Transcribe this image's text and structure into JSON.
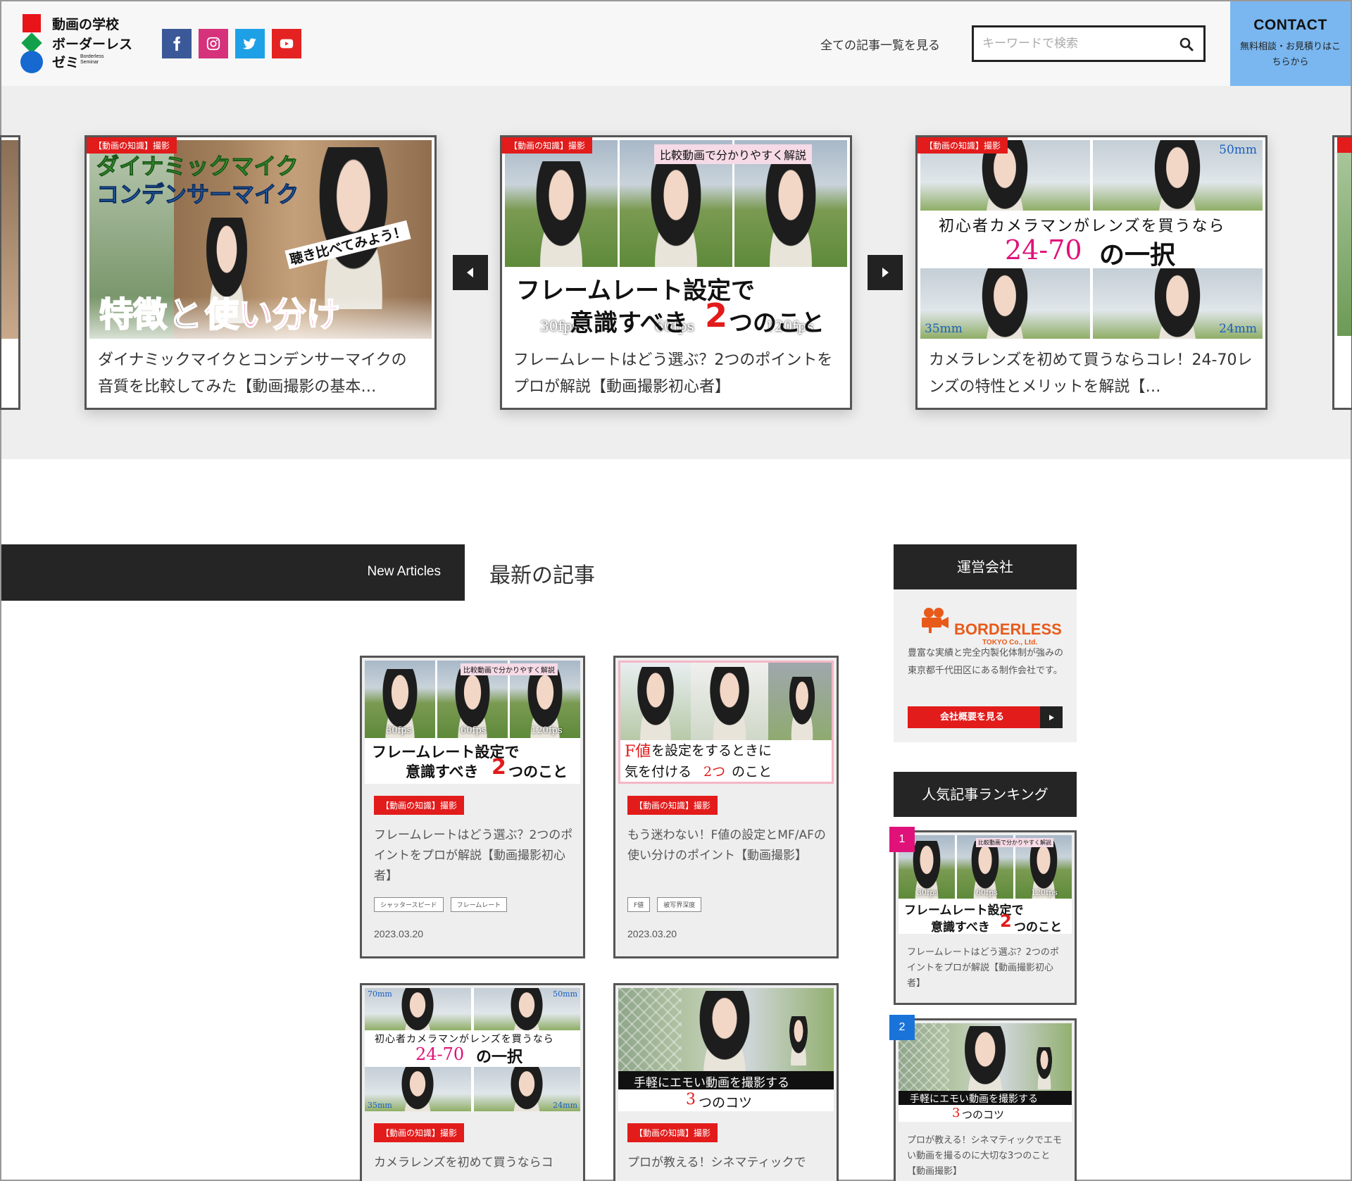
{
  "header": {
    "logo": {
      "line1": "動画の学校",
      "line2": "ボーダーレス",
      "line3": "ゼミ",
      "sub": "Borderless Seminar"
    },
    "social": [
      "facebook-icon",
      "instagram-icon",
      "twitter-icon",
      "youtube-icon"
    ],
    "all_articles_link": "全ての記事一覧を見る",
    "search": {
      "placeholder": "キーワードで検索"
    },
    "contact": {
      "title": "CONTACT",
      "subtitle": "無料相談・お見積りはこちらから"
    }
  },
  "slider": {
    "slides": [
      {
        "category": "【動画の知識】撮影",
        "title": "ダイナミックマイクとコンデンサーマイクの音質を比較してみた【動画撮影の基本…",
        "thumb_text": {
          "l1": "ダイナミックマイク",
          "l2": "コンデンサーマイク",
          "l3": "聴き比べてみよう！",
          "l4a": "特徴",
          "l4b": "と",
          "l4c": "使い分け"
        }
      },
      {
        "category": "【動画の知識】撮影",
        "title": "フレームレートはどう選ぶ？2つのポイントをプロが解説【動画撮影初心者】",
        "thumb_text": {
          "badge": "比較動画で分かりやすく解説",
          "f1": "30fps",
          "f2": "60fps",
          "f3": "120fps",
          "l1": "フレームレート設定で",
          "l2a": "意識すべき",
          "l2b": "2",
          "l2c": "つのこと"
        }
      },
      {
        "category": "【動画の知識】撮影",
        "title": "カメラレンズを初めて買うならコレ！24-70レンズの特性とメリットを解説【…",
        "thumb_text": {
          "mm1": "50mm",
          "l1": "初心者カメラマンがレンズを買うなら",
          "l2a": "24-70",
          "l2b": "の一択",
          "mm2": "35mm",
          "mm3": "24mm"
        }
      }
    ]
  },
  "new_articles": {
    "label_en": "New Articles",
    "label_jp": "最新の記事",
    "cards": [
      {
        "category": "【動画の知識】撮影",
        "title": "フレームレートはどう選ぶ？2つのポイントをプロが解説【動画撮影初心者】",
        "tags": [
          "シャッタースピード",
          "フレームレート"
        ],
        "date": "2023.03.20",
        "thumb_text": {
          "badge": "比較動画で分かりやすく解説",
          "f1": "30fps",
          "f2": "60fps",
          "f3": "120fps",
          "l1": "フレームレート設定で",
          "l2a": "意識すべき",
          "l2b": "2",
          "l2c": "つのこと"
        }
      },
      {
        "category": "【動画の知識】撮影",
        "title": "もう迷わない！F値の設定とMF/AFの使い分けのポイント【動画撮影】",
        "tags": [
          "F値",
          "被写界深度"
        ],
        "date": "2023.03.20",
        "thumb_text": {
          "l1a": "F値",
          "l1b": "を設定をするときに",
          "l2a": "気を付ける",
          "l2b": "2つ",
          "l2c": "のこと"
        }
      },
      {
        "category": "【動画の知識】撮影",
        "title": "カメラレンズを初めて買うならコ",
        "thumb_text": {
          "mm0": "70mm",
          "mm1": "50mm",
          "l1": "初心者カメラマンがレンズを買うなら",
          "l2a": "24-70",
          "l2b": "の一択",
          "mm2": "35mm",
          "mm3": "24mm"
        }
      },
      {
        "category": "【動画の知識】撮影",
        "title": "プロが教える！シネマティックで",
        "thumb_text": {
          "l1": "手軽にエモい動画を撮影する",
          "l2a": "3",
          "l2b": "つのコツ"
        }
      }
    ]
  },
  "sidebar": {
    "company_heading": "運営会社",
    "company": {
      "name": "BORDERLESS",
      "sub": "TOKYO Co., Ltd.",
      "desc": "豊富な実績と完全内製化体制が強みの東京都千代田区にある制作会社です。",
      "button": "会社概要を見る"
    },
    "ranking_heading": "人気記事ランキング",
    "ranking": [
      {
        "rank": "1",
        "title": "フレームレートはどう選ぶ？2つのポイントをプロが解説【動画撮影初心者】",
        "thumb_text": {
          "badge": "比較動画で分かりやすく解説",
          "f1": "30fps",
          "f2": "60fps",
          "f3": "120fps",
          "l1": "フレームレート設定で",
          "l2a": "意識すべき",
          "l2b": "2",
          "l2c": "つのこと"
        }
      },
      {
        "rank": "2",
        "title": "プロが教える！シネマティックでエモい動画を撮るのに大切な3つのこと【動画撮影】",
        "thumb_text": {
          "l1": "手軽にエモい動画を撮影する",
          "l2a": "3",
          "l2b": "つのコツ"
        }
      }
    ]
  },
  "colors": {
    "accent_red": "#e21b1b",
    "contact_blue": "#7ab7f0",
    "dark": "#252525",
    "rank1": "#e0127a",
    "rank2": "#1a73d9"
  }
}
